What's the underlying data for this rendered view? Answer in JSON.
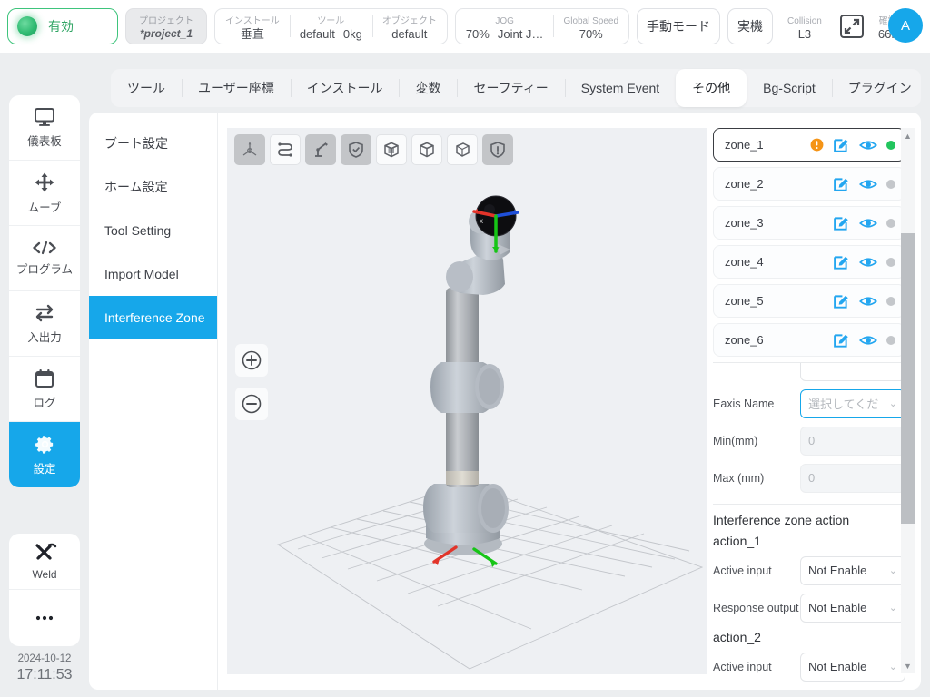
{
  "header": {
    "enable": {
      "label": "有効",
      "led_color": "#2fbb72"
    },
    "project": {
      "label": "プロジェクト",
      "value": "*project_1"
    },
    "install": {
      "label": "インストール",
      "value": "垂直"
    },
    "tool": {
      "label": "ツール",
      "value": "default",
      "payload": "0kg"
    },
    "object": {
      "label": "オブジェクト",
      "value": "default"
    },
    "jog": {
      "label": "JOG",
      "percent": "70%",
      "mode": "Joint J…"
    },
    "global_speed": {
      "label": "Global Speed",
      "value": "70%"
    },
    "mode_button": "手動モード",
    "real_button": "実機",
    "collision": {
      "label": "Collision",
      "value": "L3"
    },
    "confirm": {
      "label": "確認",
      "value": "66ff"
    },
    "avatar": {
      "initial": "A",
      "color": "#16a7ea"
    }
  },
  "rail": {
    "items": [
      {
        "label": "儀表板",
        "icon": "monitor-icon",
        "active": false
      },
      {
        "label": "ムーブ",
        "icon": "move-arrows-icon",
        "active": false
      },
      {
        "label": "プログラム",
        "icon": "code-icon",
        "active": false
      },
      {
        "label": "入出力",
        "icon": "io-swap-icon",
        "active": false
      },
      {
        "label": "ログ",
        "icon": "calendar-icon",
        "active": false
      },
      {
        "label": "設定",
        "icon": "gear-icon",
        "active": true
      }
    ],
    "secondary": [
      {
        "label": "Weld",
        "icon": "weld-torch-icon"
      },
      {
        "label": "…",
        "icon": "ellipsis-icon"
      }
    ],
    "clock": {
      "date": "2024-10-12",
      "time": "17:11:53"
    }
  },
  "tabs": [
    {
      "label": "ツール",
      "active": false
    },
    {
      "label": "ユーザー座標",
      "active": false
    },
    {
      "label": "インストール",
      "active": false
    },
    {
      "label": "変数",
      "active": false
    },
    {
      "label": "セーフティー",
      "active": false
    },
    {
      "label": "System Event",
      "active": false
    },
    {
      "label": "その他",
      "active": true
    },
    {
      "label": "Bg-Script",
      "active": false
    },
    {
      "label": "プラグイン",
      "active": false
    }
  ],
  "submenu": [
    {
      "label": "ブート設定",
      "active": false
    },
    {
      "label": "ホーム設定",
      "active": false
    },
    {
      "label": "Tool Setting",
      "active": false
    },
    {
      "label": "Import Model",
      "active": false
    },
    {
      "label": "Interference Zone",
      "active": true
    }
  ],
  "viewport": {
    "tools": [
      {
        "name": "axis-tripod-icon",
        "state": "off"
      },
      {
        "name": "path-loop-icon",
        "state": "on"
      },
      {
        "name": "robot-arm-icon",
        "state": "off"
      },
      {
        "name": "shield-check-icon",
        "state": "off"
      },
      {
        "name": "cube-filled-icon",
        "state": "on"
      },
      {
        "name": "cube-outline-icon",
        "state": "on"
      },
      {
        "name": "cube-wire-icon",
        "state": "on"
      },
      {
        "name": "shield-alert-icon",
        "state": "off"
      }
    ],
    "zoom_in": "+",
    "zoom_out": "−"
  },
  "zones": [
    {
      "name": "zone_1",
      "selected": true,
      "warning": true,
      "enabled": true
    },
    {
      "name": "zone_2",
      "selected": false,
      "warning": false,
      "enabled": false
    },
    {
      "name": "zone_3",
      "selected": false,
      "warning": false,
      "enabled": false
    },
    {
      "name": "zone_4",
      "selected": false,
      "warning": false,
      "enabled": false
    },
    {
      "name": "zone_5",
      "selected": false,
      "warning": false,
      "enabled": false
    },
    {
      "name": "zone_6",
      "selected": false,
      "warning": false,
      "enabled": false
    }
  ],
  "form": {
    "eaxis_name": {
      "label": "Eaxis Name",
      "value": "選択してくだ",
      "placeholder": "選択してくだ"
    },
    "min_mm": {
      "label": "Min(mm)",
      "value": "0"
    },
    "max_mm": {
      "label": "Max (mm)",
      "value": "0"
    },
    "action_section_title": "Interference zone action",
    "action_1": {
      "title": "action_1",
      "active_input": {
        "label": "Active input",
        "value": "Not Enable"
      },
      "response_output": {
        "label": "Response output",
        "value": "Not Enable"
      }
    },
    "action_2": {
      "title": "action_2",
      "active_input": {
        "label": "Active input",
        "value": "Not Enable"
      }
    }
  }
}
